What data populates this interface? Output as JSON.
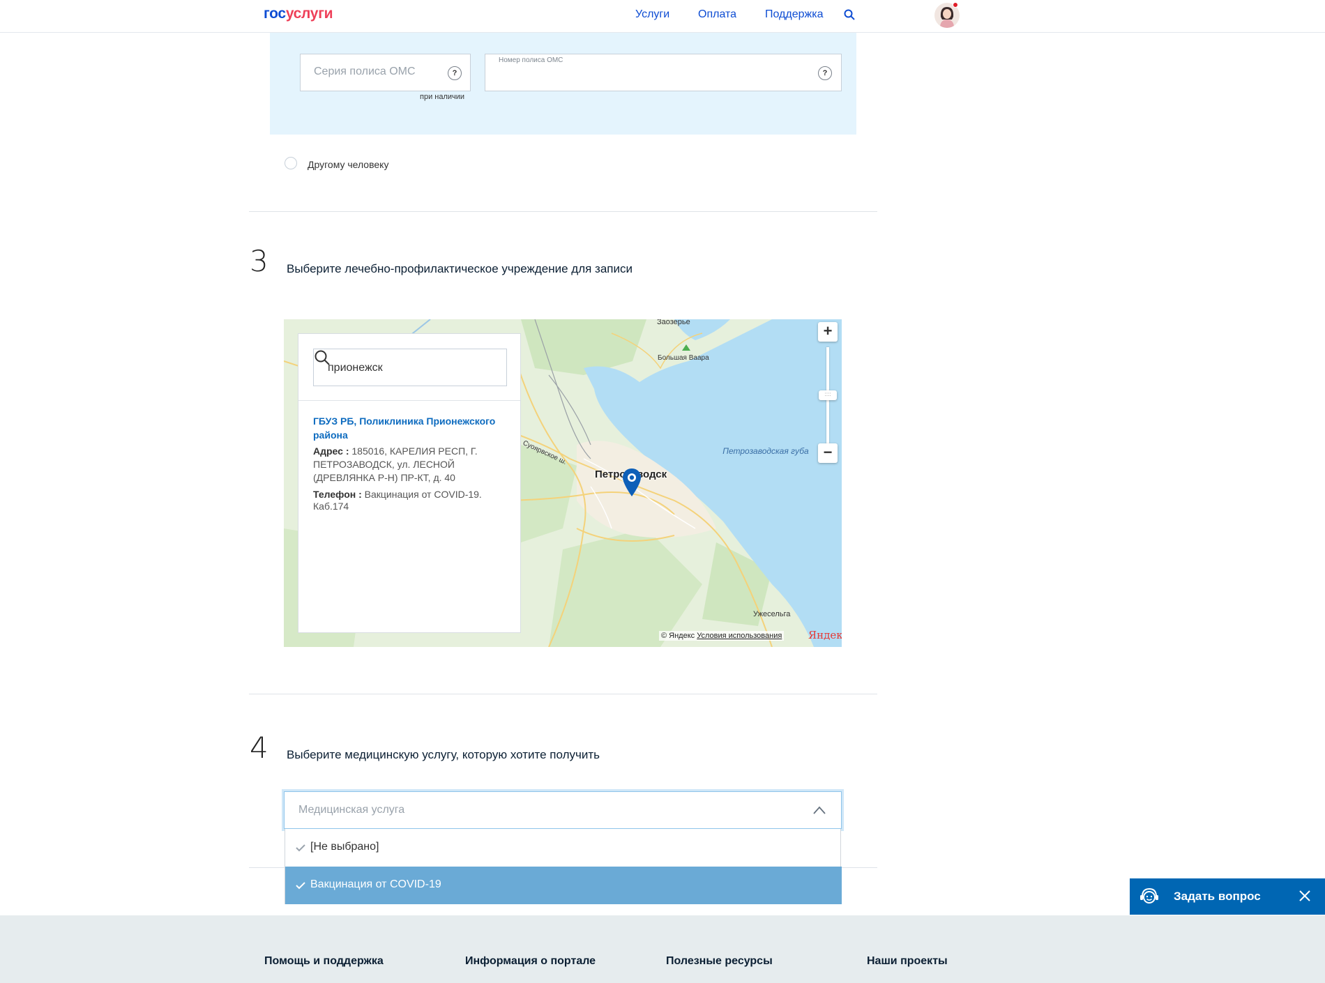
{
  "header": {
    "logo_part1": "гос",
    "logo_part2": "услуги",
    "nav": [
      "Услуги",
      "Оплата",
      "Поддержка"
    ]
  },
  "section2": {
    "series_placeholder": "Серия полиса ОМС",
    "series_hint": "при наличии",
    "number_label": "Номер полиса ОМС",
    "number_value": "",
    "help_mark": "?",
    "other_person_label": "Другому человеку"
  },
  "section3": {
    "number": "3",
    "title": "Выберите лечебно-профилактическое учреждение для записи",
    "search_value": "прионежск",
    "clinic": {
      "name": "ГБУЗ РБ, Поликлиника Прионежского района",
      "address_label": "Адрес :",
      "address": "185016, КАРЕЛИЯ РЕСП, Г. ПЕТРОЗАВОДСК, ул. ЛЕСНОЙ (ДРЕВЛЯНКА Р-Н) ПР-КТ, д. 40",
      "phone_label": "Телефон :",
      "phone": "Вакцинация от COVID-19. Каб.174"
    },
    "map": {
      "city": "Петрозаводск",
      "labels": [
        "Заозерье",
        "Большая Ваара",
        "Ужесельга",
        "Суоярвское ш."
      ],
      "water": "Петрозаводская губа",
      "copyright": "© Яндекс",
      "terms": "Условия использования",
      "logo": "Яндекс",
      "zoom_in": "+",
      "zoom_out": "−"
    }
  },
  "section4": {
    "number": "4",
    "title": "Выберите медицинскую услугу, которую хотите получить",
    "select_placeholder": "Медицинская услуга",
    "options": [
      "[Не выбрано]",
      "Вакцинация от COVID-19"
    ],
    "selected_index": 1
  },
  "chat": {
    "label": "Задать вопрос"
  },
  "footer": {
    "columns": [
      "Помощь и поддержка",
      "Информация о портале",
      "Полезные ресурсы",
      "Наши проекты"
    ]
  },
  "colors": {
    "brand_blue": "#0d4cd3",
    "brand_red": "#ee3f58",
    "panel_blue": "#e4f4fd",
    "selected_option": "#6aaad6",
    "chat_bg": "#0066b3"
  }
}
